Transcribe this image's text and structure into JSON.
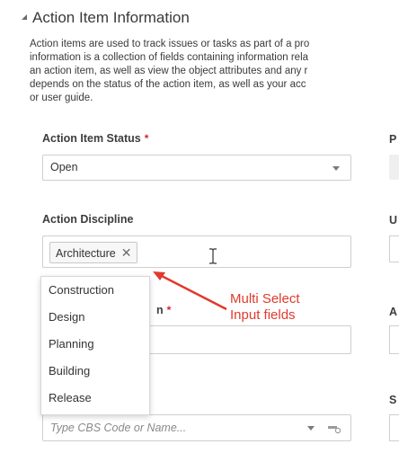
{
  "section": {
    "title": "Action Item Information",
    "description_lines": [
      "Action items are used to track issues or tasks as part of a pro",
      "information is a collection of fields containing information rela",
      "an action item, as well as view the object attributes and any r",
      "depends on the status of the action item, as well as your acc",
      "or user guide."
    ]
  },
  "fields": {
    "status": {
      "label": "Action Item Status",
      "required_mark": "*",
      "value": "Open"
    },
    "discipline": {
      "label": "Action Discipline",
      "selected_chip": "Architecture",
      "chip_remove": "✕",
      "options": [
        "Construction",
        "Design",
        "Planning",
        "Building",
        "Release"
      ]
    },
    "hidden_field": {
      "label_fragment": "n",
      "required_mark": "*"
    },
    "cbs": {
      "placeholder": "Type CBS Code or Name..."
    }
  },
  "right_column": {
    "labels": [
      "P",
      "U",
      "A",
      "S"
    ]
  },
  "annotation": {
    "line1": "Multi Select",
    "line2": "Input fields",
    "color": "#e03a2d"
  },
  "icons": {
    "cursor": "i-beam-cursor-icon",
    "caret": "caret-down-icon",
    "lookup": "lookup-icon"
  }
}
